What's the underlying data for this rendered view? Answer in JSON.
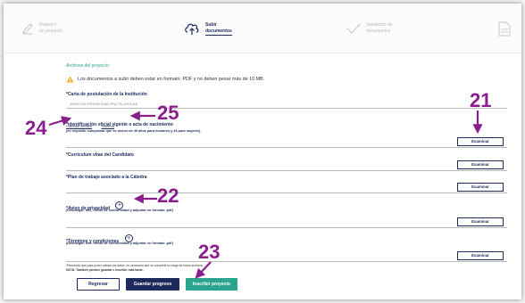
{
  "stepper": {
    "step1": {
      "line1": "Registro",
      "line2": "de proyecto"
    },
    "step2": {
      "line1": "Subir",
      "line2": "documentos"
    },
    "step3": {
      "line1": "Validación de",
      "line2": "documentos"
    }
  },
  "main": {
    "section_title": "Archivos del proyecto",
    "warning": "Los documentos a subir deben estar en formato .PDF y no deben pesar más de 10 MB.",
    "fields": [
      {
        "label": "*Carta de postulación de la Institución",
        "file": "AVISO-DE-PRIVACIDAD-PNCTA-2019.pdf"
      },
      {
        "label": "*Identificación oficial vigente o acta de nacimiento",
        "sub": "(es requisito comprobar que es menor de 40 años para hombres y 43 para mujeres)",
        "change_link": "Cambiar archivo",
        "delete_link": "Eliminar"
      },
      {
        "label": "*Currículum vitae del Candidato"
      },
      {
        "label": "*Plan de trabajo asociado a la Cátedra"
      },
      {
        "label": "*Aviso de privacidad",
        "sub": "(Descargar, leer, firmar de conformidad y adjuntar en formato .pdf)"
      },
      {
        "label": "*Términos y condiciones",
        "sub": "(Descargar, leer, firmar de conformidad y adjuntar en formato .pdf)"
      }
    ],
    "browse_label": "Examinar",
    "note_line1": "*Recuerda que para poder validar tus datos, es necesario que se complete la carga de todos archivos.",
    "note_line2": "NOTA: También puedes guardar e inscribir más tarde."
  },
  "buttons": {
    "back": "Regresar",
    "save": "Guardar progreso",
    "submit": "Inscribir proyecto"
  },
  "annotations": {
    "a21": "21",
    "a22": "22",
    "a23": "23",
    "a24": "24",
    "a25": "25"
  },
  "colors": {
    "navy": "#1f2a5c",
    "teal": "#2aa48e",
    "purple": "#8a1e8c",
    "warning": "#f2b233"
  }
}
